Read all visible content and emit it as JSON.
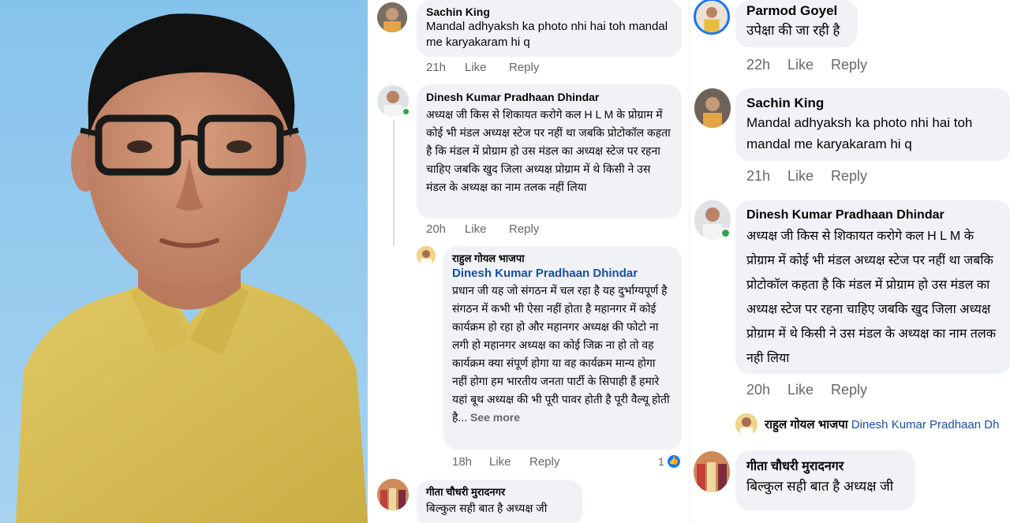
{
  "comments_mid": [
    {
      "author": "Sachin King",
      "text": "Mandal adhyaksh ka photo nhi hai toh mandal me karyakaram hi q",
      "time": "21h",
      "like": "Like",
      "reply": "Reply"
    },
    {
      "author": "Dinesh Kumar Pradhaan Dhindar",
      "text": "अध्यक्ष जी किस से शिकायत करोगे कल H L M के प्रोग्राम में कोई भी मंडल अध्यक्ष स्टेज पर नहीं था जबकि प्रोटोकॉल कहता है कि मंडल में प्रोग्राम हो उस मंडल का अध्यक्ष स्टेज पर रहना चाहिए जबकि खुद जिला अध्यक्ष प्रोग्राम में थे किसी ने उस मंडल के अध्यक्ष का नाम तलक नहीं लिया",
      "time": "20h",
      "like": "Like",
      "reply": "Reply"
    },
    {
      "author": "राहुल गोयल भाजपा",
      "mention": "Dinesh Kumar Pradhaan Dhindar",
      "text": "प्रधान जी यह जो संगठन में चल रहा है यह दुर्भाग्यपूर्ण है संगठन में कभी भी ऐसा नहीं होता है महानगर में कोई कार्यक्रम हो रहा हो और महानगर अध्यक्ष की फोटो ना लगी हो महानगर अध्यक्ष का कोई जिक्र ना हो तो वह कार्यक्रम क्या संपूर्ण होगा या वह कार्यक्रम मान्य होगा नहीं होगा हम भारतीय जनता पार्टी के सिपाही हैं हमारे यहां बूथ अध्यक्ष की भी पूरी पावर होती है पूरी वैल्यू होती है...",
      "see_more": "See more",
      "time": "18h",
      "like": "Like",
      "reply": "Reply",
      "reaction_count": "1"
    },
    {
      "author": "गीता चौधरी मुरादनगर",
      "text": "बिल्कुल सही बात है अध्यक्ष जी"
    }
  ],
  "comments_right": [
    {
      "author": "Parmod Goyel",
      "text": "उपेक्षा की जा रही है",
      "time": "22h",
      "like": "Like",
      "reply": "Reply"
    },
    {
      "author": "Sachin King",
      "text": "Mandal adhyaksh ka photo nhi hai toh mandal me karyakaram hi q",
      "time": "21h",
      "like": "Like",
      "reply": "Reply"
    },
    {
      "author": "Dinesh Kumar Pradhaan Dhindar",
      "text": "अध्यक्ष जी किस से शिकायत करोगे कल H L M के प्रोग्राम में कोई भी मंडल अध्यक्ष स्टेज पर नहीं था जबकि प्रोटोकॉल कहता है कि मंडल में प्रोग्राम हो उस मंडल का अध्यक्ष स्टेज पर रहना चाहिए जबकि खुद जिला अध्यक्ष प्रोग्राम में थे किसी ने उस मंडल के अध्यक्ष का नाम तलक नही लिया",
      "time": "20h",
      "like": "Like",
      "reply": "Reply"
    },
    {
      "author": "राहुल गोयल भाजपा",
      "mention": "Dinesh Kumar Pradhaan Dh"
    },
    {
      "author": "गीता चौधरी मुरादनगर",
      "text": "बिल्कुल सही बात है अध्यक्ष जी"
    }
  ],
  "colors": {
    "bubble": "#f0f2f5",
    "meta": "#65676b",
    "online": "#31a24c",
    "mention": "#1b4fa0",
    "like_blue": "#1877f2",
    "portrait_bg": "#8fc6ea",
    "shirt": "#dcc35a"
  },
  "icons": [
    "like-reaction-icon",
    "online-status-icon"
  ]
}
